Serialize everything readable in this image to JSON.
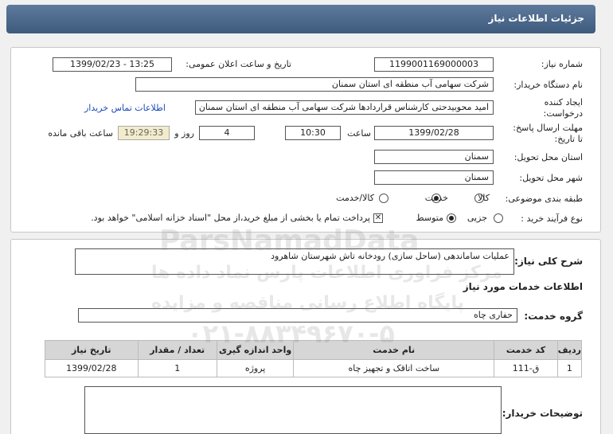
{
  "header": {
    "title": "جزئیات اطلاعات نیاز"
  },
  "info": {
    "need_number_label": "شماره نیاز:",
    "need_number": "1199001169000003",
    "announce_label": "تاریخ و ساعت اعلان عمومی:",
    "announce_value": "1399/02/23 - 13:25",
    "buyer_label": "نام دستگاه خریدار:",
    "buyer_value": "شرکت سهامی آب منطقه ای استان سمنان",
    "creator_label_1": "ایجاد کننده",
    "creator_label_2": "درخواست:",
    "creator_value": "امید محوبیدحتی کارشناس قراردادها شرکت سهامی آب منطقه ای استان سمنان",
    "contact_link": "اطلاعات تماس خریدار",
    "deadline_label_1": "مهلت ارسال پاسخ:",
    "deadline_label_2": "تا تاریخ:",
    "deadline_date": "1399/02/28",
    "time_label": "ساعت",
    "deadline_time": "10:30",
    "days_value": "4",
    "days_label": "روز و",
    "remaining_value": "19:29:33",
    "remaining_label": "ساعت باقی مانده",
    "province_label": "استان محل تحویل:",
    "province_value": "سمنان",
    "city_label": "شهر محل تحویل:",
    "city_value": "سمنان",
    "category_label": "طبقه بندی موضوعی:",
    "category_options": [
      "کالا",
      "خدمت",
      "کالا/خدمت"
    ],
    "category_selected": "خدمت",
    "process_label": "نوع فرآیند خرید :",
    "process_options": [
      "جزیی",
      "متوسط"
    ],
    "process_selected": "متوسط",
    "payment_note": "پرداخت تمام یا بخشی از مبلغ خرید،از محل \"اسناد خزانه اسلامی\" خواهد بود."
  },
  "details": {
    "description_label": "شرح کلی نیاز:",
    "description_value": "عملیات ساماندهی (ساحل سازی) رودخانه تاش شهرستان شاهرود",
    "services_heading": "اطلاعات خدمات مورد نیاز",
    "group_label": "گروه خدمت:",
    "group_value": "حفاری چاه",
    "table": {
      "headers": [
        "ردیف",
        "کد خدمت",
        "نام خدمت",
        "واحد اندازه گیری",
        "تعداد / مقدار",
        "تاریخ نیاز"
      ],
      "rows": [
        [
          "1",
          "ق-111",
          "ساخت اتاقک و تجهیز چاه",
          "پروژه",
          "1",
          "1399/02/28"
        ]
      ]
    },
    "buyer_notes_label": "توضیحات خریدار:"
  },
  "watermark": {
    "brand": "ParsNamadData",
    "line1": "مرکز فراوری اطلاعات پارس نماد داده ها",
    "line2": "پایگاه اطلاع رسانی مناقصه و مزایده",
    "phone": "۰۲۱-۸۸۳۴۹۶۷۰-۵"
  },
  "colors": {
    "header": "#4a6890",
    "link": "#1a4bb8",
    "remaining_bg": "#f2eccc"
  }
}
